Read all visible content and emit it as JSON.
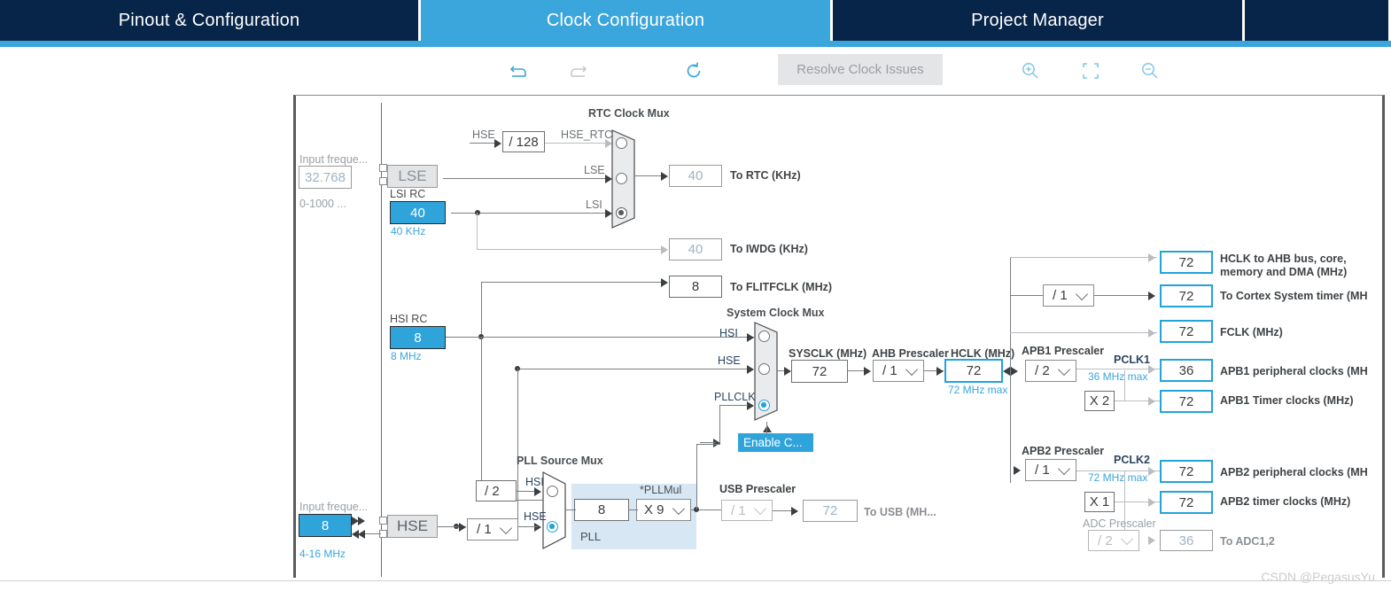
{
  "tabs": [
    {
      "label": "Pinout & Configuration",
      "active": false
    },
    {
      "label": "Clock Configuration",
      "active": true
    },
    {
      "label": "Project Manager",
      "active": false
    },
    {
      "label": "",
      "active": false
    }
  ],
  "toolbar": {
    "undo": "undo-icon",
    "redo": "redo-icon",
    "reset": "reset-icon",
    "resolve_label": "Resolve Clock Issues",
    "zoom_in": "zoom-in-icon",
    "fit": "fit-to-screen-icon",
    "zoom_out": "zoom-out-icon"
  },
  "diagram": {
    "lse": {
      "input_freq_label": "Input freque...",
      "value": "32.768",
      "range": "0-1000 ...",
      "osc_label": "LSE"
    },
    "lsi": {
      "title": "LSI RC",
      "value": "40",
      "unit": "40 KHz"
    },
    "hsi": {
      "title": "HSI RC",
      "value": "8",
      "unit": "8 MHz"
    },
    "hse": {
      "input_freq_label": "Input freque...",
      "value": "8",
      "range": "4-16 MHz",
      "osc_label": "HSE"
    },
    "hse_rtc_div": {
      "value": "/ 128",
      "in_label": "HSE",
      "out_label": "HSE_RTC"
    },
    "rtc_mux": {
      "title": "RTC Clock Mux",
      "inputs": [
        "HSE_RTC",
        "LSE",
        "LSI"
      ],
      "selected": 2
    },
    "to_rtc": {
      "value": "40",
      "label": "To RTC (KHz)"
    },
    "to_iwdg": {
      "value": "40",
      "label": "To IWDG (KHz)"
    },
    "to_flitfclk": {
      "value": "8",
      "label": "To FLITFCLK (MHz)"
    },
    "sys_mux": {
      "title": "System Clock Mux",
      "inputs": [
        "HSI",
        "HSE",
        "PLLCLK"
      ],
      "selected": 2,
      "enable_css": "Enable C..."
    },
    "sysclk": {
      "label": "SYSCLK (MHz)",
      "value": "72"
    },
    "ahb_prescaler": {
      "label": "AHB Prescaler",
      "value": "/ 1"
    },
    "hclk": {
      "label": "HCLK (MHz)",
      "value": "72",
      "max": "72 MHz max"
    },
    "hclk_out": {
      "value": "72",
      "label_line1": "HCLK to AHB bus, core,",
      "label_line2": "memory and DMA (MHz)"
    },
    "cortex_prescaler": {
      "value": "/ 1"
    },
    "cortex_out": {
      "value": "72",
      "label": "To Cortex System timer (MH"
    },
    "fclk_out": {
      "value": "72",
      "label": "FCLK (MHz)"
    },
    "apb1": {
      "prescaler_label": "APB1 Prescaler",
      "prescaler": "/ 2",
      "pclk_label": "PCLK1",
      "max": "36 MHz max",
      "periph_value": "36",
      "periph_label": "APB1 peripheral clocks (MH",
      "timer_mul": "X 2",
      "timer_value": "72",
      "timer_label": "APB1 Timer clocks (MHz)"
    },
    "apb2": {
      "prescaler_label": "APB2 Prescaler",
      "prescaler": "/ 1",
      "pclk_label": "PCLK2",
      "max": "72 MHz max",
      "periph_value": "72",
      "periph_label": "APB2 peripheral clocks (MH",
      "timer_mul": "X 1",
      "timer_value": "72",
      "timer_label": "APB2 timer clocks (MHz)"
    },
    "adc": {
      "prescaler_label": "ADC Prescaler",
      "prescaler": "/ 2",
      "value": "36",
      "label": "To ADC1,2"
    },
    "pll_source_mux": {
      "title": "PLL Source Mux",
      "inputs": [
        "HSI",
        "HSE"
      ],
      "selected": 1
    },
    "hsi_div2": {
      "value": "/ 2"
    },
    "hse_div": {
      "value": "/ 1"
    },
    "pll": {
      "block_label": "PLL",
      "input_value": "8",
      "mul_label": "*PLLMul",
      "mul_value": "X 9"
    },
    "usb": {
      "prescaler_label": "USB Prescaler",
      "prescaler": "/ 1",
      "value": "72",
      "label": "To USB (MH..."
    }
  },
  "watermark": "CSDN @PegasusYu",
  "colors": {
    "tab_active": "#3BA6DC",
    "tab_inactive": "#072449",
    "highlight": "#22A3DA",
    "selected_fill": "#2FA4DB",
    "pll_block": "#d7e7f4"
  }
}
